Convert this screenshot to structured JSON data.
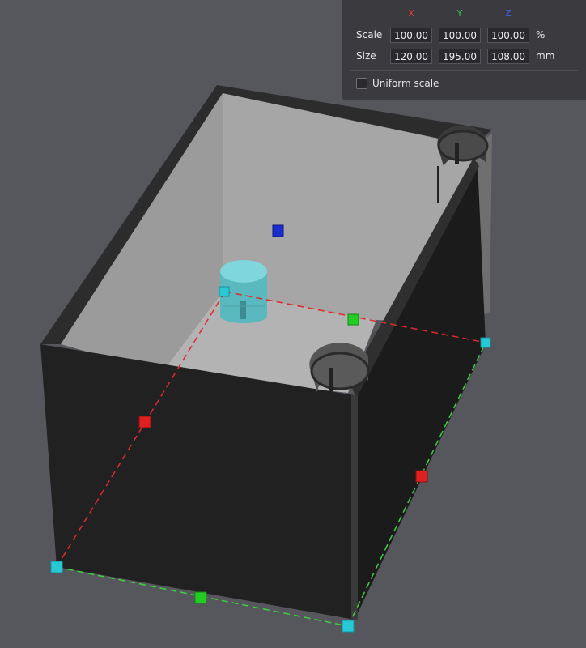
{
  "scale_panel": {
    "axes": {
      "x": {
        "label": "X",
        "color": "#e23b3b"
      },
      "y": {
        "label": "Y",
        "color": "#3fc13f"
      },
      "z": {
        "label": "Z",
        "color": "#3f5fe0"
      }
    },
    "scale": {
      "label": "Scale",
      "x": "100.00",
      "y": "100.00",
      "z": "100.00",
      "unit": "%"
    },
    "size": {
      "label": "Size",
      "x": "120.00",
      "y": "195.00",
      "z": "108.00",
      "unit": "mm"
    },
    "uniform_scale": {
      "label": "Uniform scale",
      "checked": false
    }
  },
  "viewport": {
    "background_color": "#56565d",
    "model_color": "#1f1f1f",
    "selection_handle_color": "#27c9d6"
  }
}
